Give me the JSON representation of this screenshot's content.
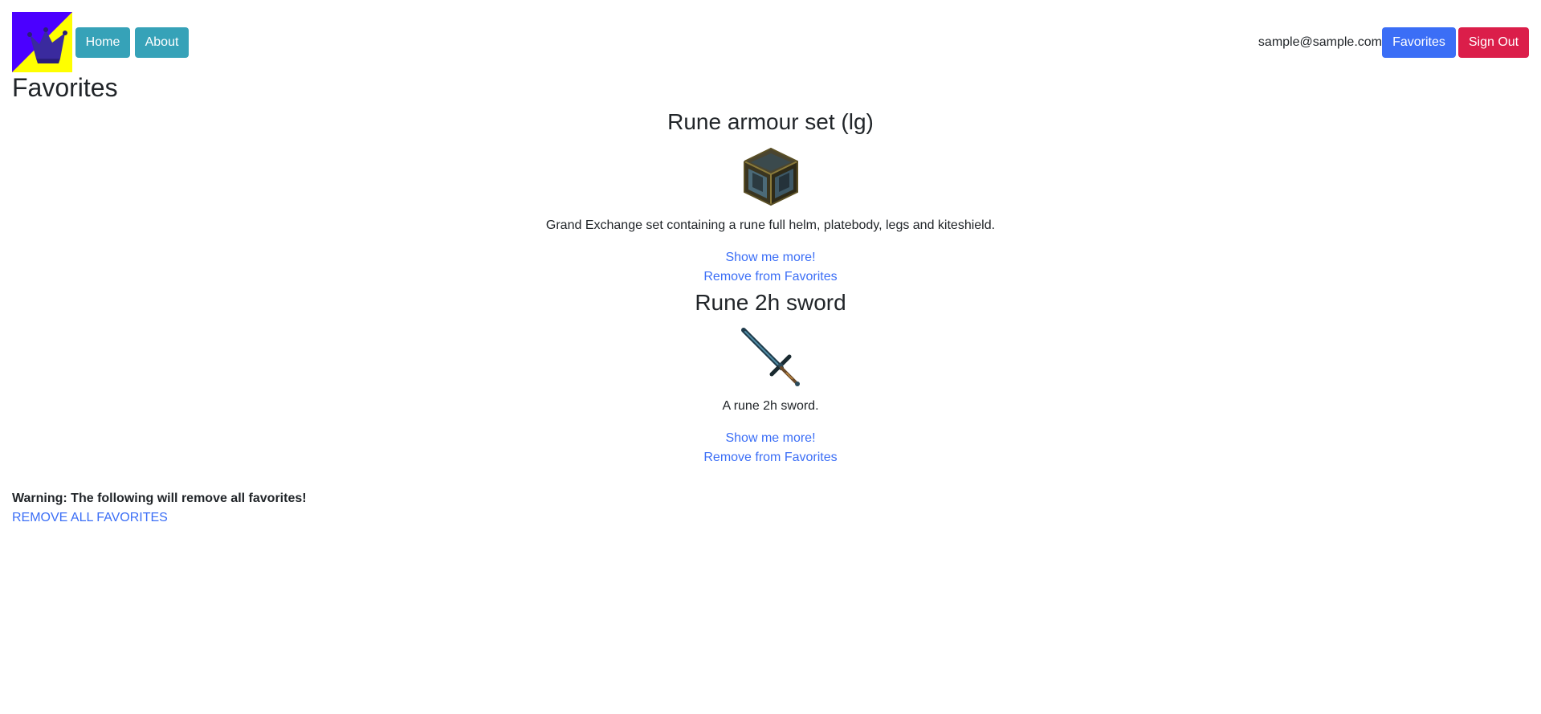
{
  "navbar": {
    "logo_icon": "crown-logo-icon",
    "home_label": "Home",
    "about_label": "About",
    "user_email": "sample@sample.com",
    "favorites_label": "Favorites",
    "signout_label": "Sign Out"
  },
  "colors": {
    "info": "#36a2b8",
    "primary": "#3b6ef6",
    "danger": "#db1e4a",
    "logo_yellow": "#ffff00",
    "logo_purple": "#4b00ff",
    "link": "#3b6ef6"
  },
  "page": {
    "title": "Favorites"
  },
  "favorites": [
    {
      "name": "Rune armour set (lg)",
      "icon": "rune-armour-set-icon",
      "description": "Grand Exchange set containing a rune full helm, platebody, legs and kiteshield.",
      "more_label": "Show me more!",
      "remove_label": "Remove from Favorites"
    },
    {
      "name": "Rune 2h sword",
      "icon": "rune-2h-sword-icon",
      "description": "A rune 2h sword.",
      "more_label": "Show me more!",
      "remove_label": "Remove from Favorites"
    }
  ],
  "footer": {
    "warning": "Warning: The following will remove all favorites!",
    "remove_all_label": "REMOVE ALL FAVORITES"
  }
}
